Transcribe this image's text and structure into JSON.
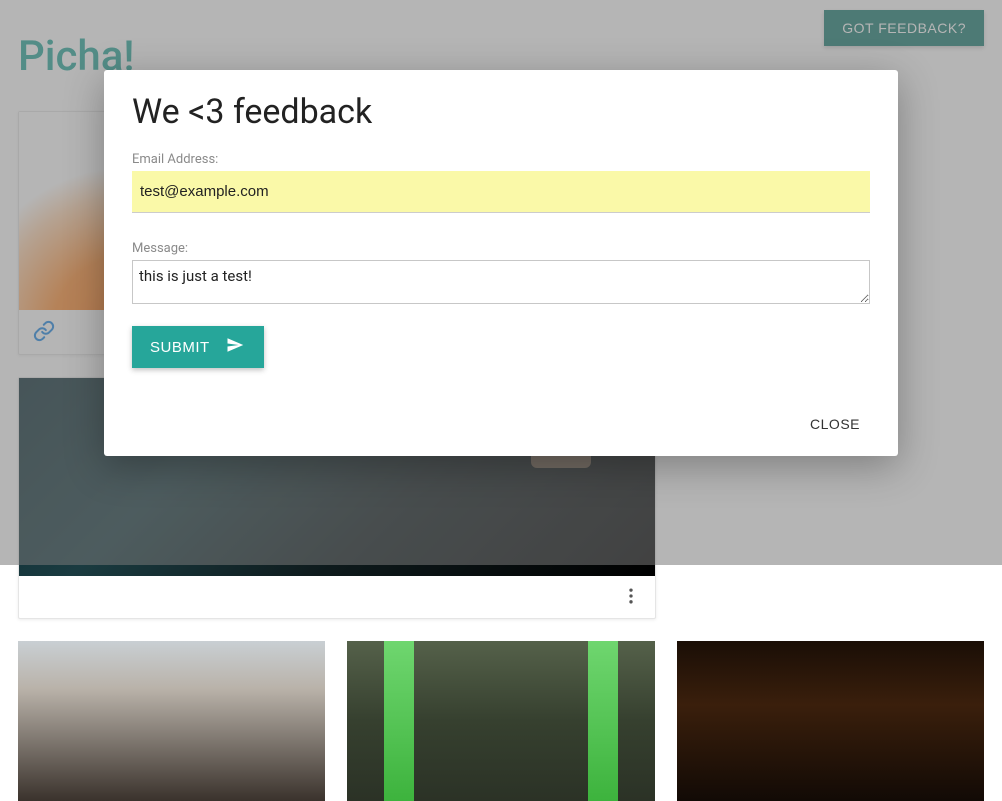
{
  "header": {
    "brand": "Picha!",
    "feedback_button": "GOT FEEDBACK?"
  },
  "modal": {
    "title": "We <3 feedback",
    "email_label": "Email Address:",
    "email_value": "test@example.com",
    "message_label": "Message:",
    "message_value": "this is just a test!",
    "submit_label": "SUBMIT",
    "close_label": "CLOSE"
  }
}
